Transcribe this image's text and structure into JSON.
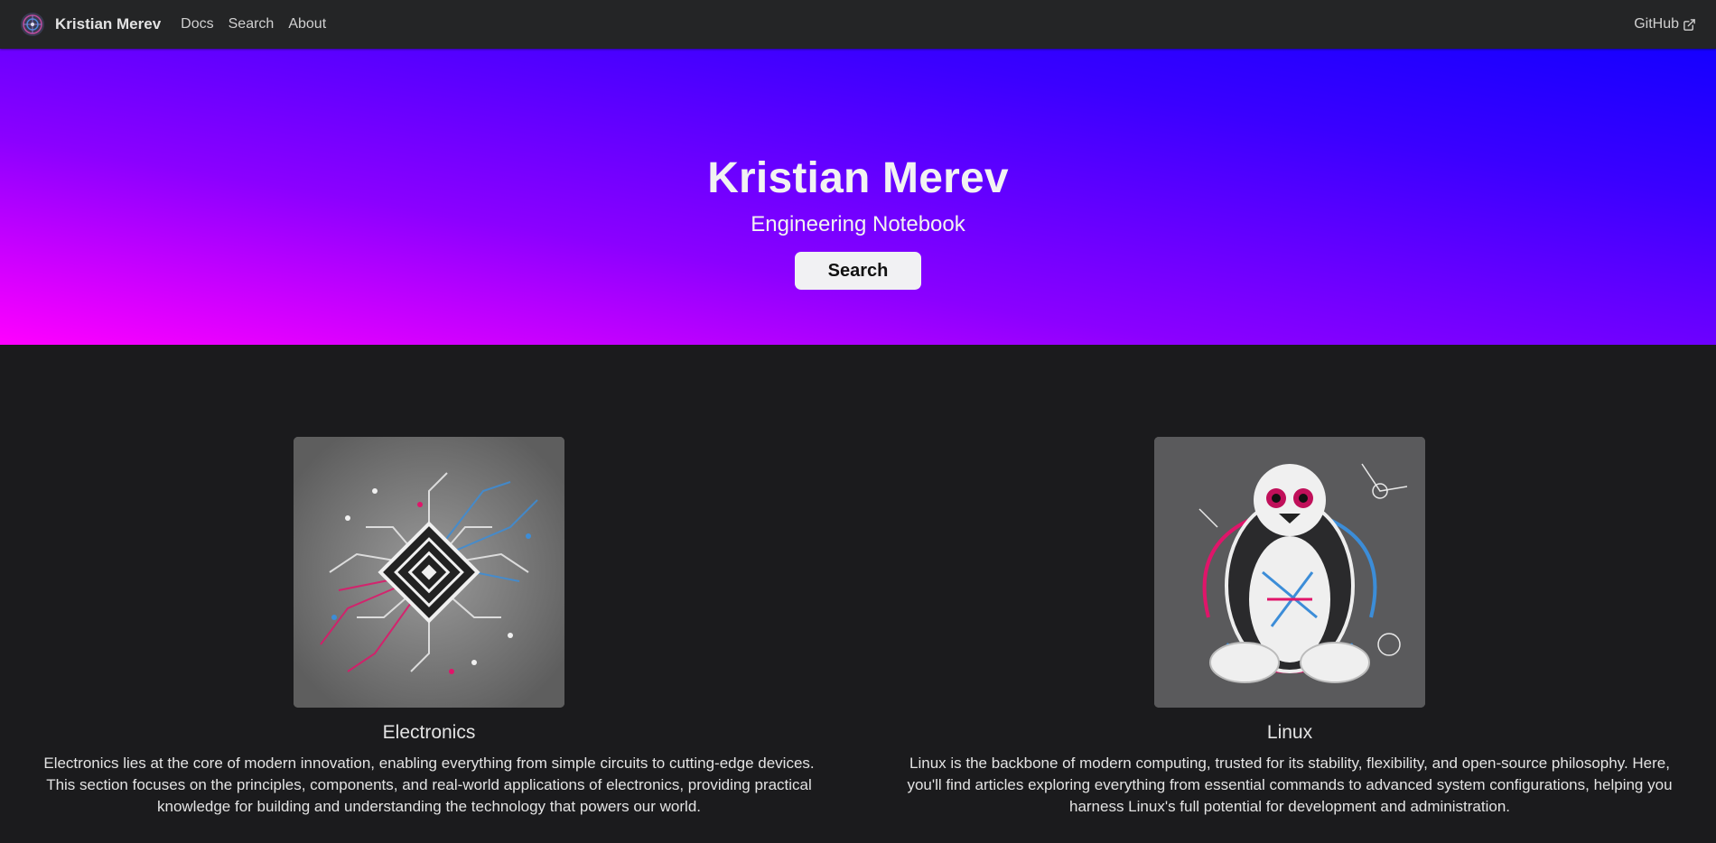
{
  "navbar": {
    "logo_icon": "circuit-globe-logo-icon",
    "brand": "Kristian Merev",
    "links": [
      "Docs",
      "Search",
      "About"
    ],
    "github": "GitHub",
    "github_icon": "external-link-icon"
  },
  "hero": {
    "title": "Kristian Merev",
    "subtitle": "Engineering Notebook",
    "button": "Search",
    "gradient_colors": [
      "#ff00ff",
      "#8b00ff",
      "#1500ff"
    ]
  },
  "features": [
    {
      "title": "Electronics",
      "image_icon": "circuit-chip-image",
      "description": "Electronics lies at the core of modern innovation, enabling everything from simple circuits to cutting-edge devices. This section focuses on the principles, components, and real-world applications of electronics, providing practical knowledge for building and understanding the technology that powers our world."
    },
    {
      "title": "Linux",
      "image_icon": "linux-penguin-image",
      "description": "Linux is the backbone of modern computing, trusted for its stability, flexibility, and open-source philosophy. Here, you'll find articles exploring everything from essential commands to advanced system configurations, helping you harness Linux's full potential for development and administration."
    }
  ],
  "colors": {
    "navbar_bg": "#242526",
    "page_bg": "#1b1b1d",
    "text": "#e3e3e3",
    "accent_pink": "#e0156a",
    "accent_blue": "#3c8dd8"
  }
}
